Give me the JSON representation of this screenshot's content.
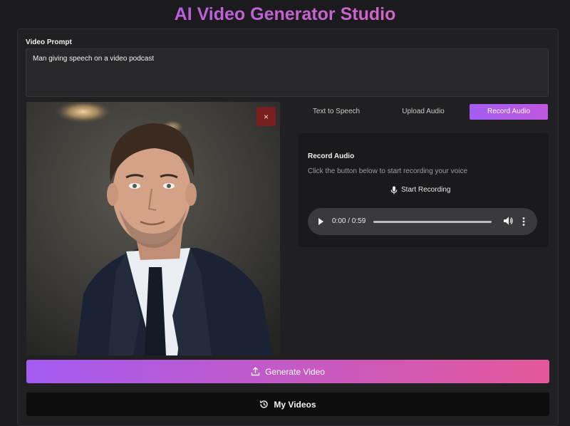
{
  "app": {
    "title": "AI Video Generator Studio"
  },
  "prompt": {
    "label": "Video Prompt",
    "value": "Man giving speech on a video podcast"
  },
  "image": {
    "close_label": "×"
  },
  "tabs": [
    {
      "label": "Text to Speech",
      "active": false
    },
    {
      "label": "Upload Audio",
      "active": false
    },
    {
      "label": "Record Audio",
      "active": true
    }
  ],
  "record": {
    "title": "Record Audio",
    "description": "Click the button below to start recording your voice",
    "button_label": "Start Recording"
  },
  "player": {
    "time": "0:00 / 0:59",
    "progress": 0
  },
  "actions": {
    "generate_label": "Generate Video",
    "my_videos_label": "My Videos"
  },
  "colors": {
    "accent_purple": "#a45bf1",
    "accent_pink": "#e4589a",
    "close_red": "#7a1f1f",
    "background": "#1b1b1d"
  }
}
